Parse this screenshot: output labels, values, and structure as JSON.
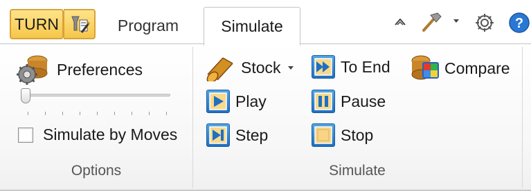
{
  "tabbar": {
    "turn_label": "TURN",
    "tabs": [
      {
        "label": "Program",
        "active": false
      },
      {
        "label": "Simulate",
        "active": true
      }
    ],
    "icons": [
      "machine-config-icon",
      "collapse-ribbon-icon",
      "hammer-icon",
      "dropdown-arrow-icon",
      "settings-gear-icon",
      "help-icon"
    ]
  },
  "options": {
    "preferences_label": "Preferences",
    "simulate_by_moves_label": "Simulate by Moves",
    "simulate_by_moves_checked": false,
    "group_label": "Options"
  },
  "simulate": {
    "stock_label": "Stock",
    "play_label": "Play",
    "step_label": "Step",
    "to_end_label": "To End",
    "pause_label": "Pause",
    "stop_label": "Stop",
    "compare_label": "Compare",
    "group_label": "Simulate"
  },
  "colors": {
    "turn_accent": "#f6c64a",
    "media_blue": "#1f6fc2",
    "stop_yellow": "#f7d488"
  }
}
